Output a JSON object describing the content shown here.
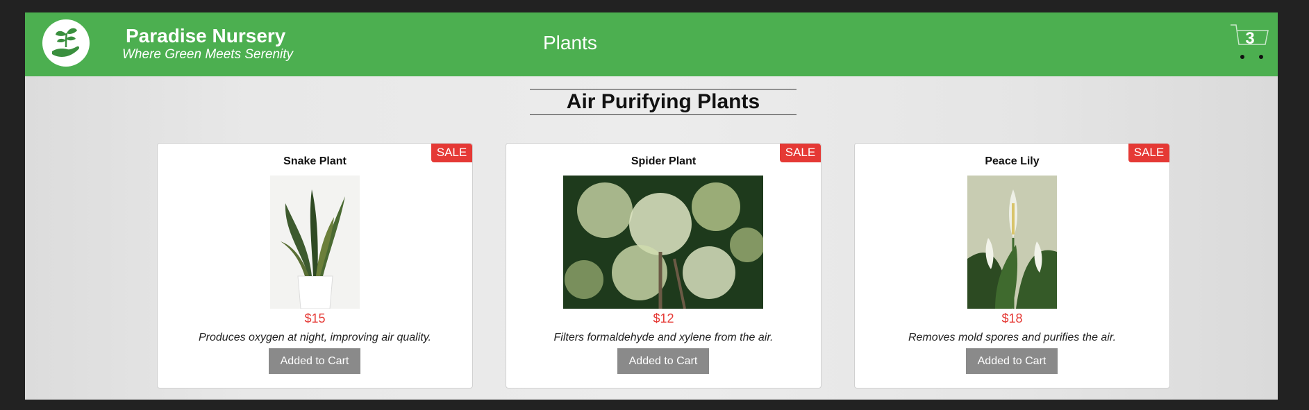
{
  "header": {
    "brand_name": "Paradise Nursery",
    "brand_tagline": "Where Green Meets Serenity",
    "nav_label": "Plants",
    "cart_count": "3"
  },
  "section": {
    "title": "Air Purifying Plants"
  },
  "products": [
    {
      "name": "Snake Plant",
      "badge": "SALE",
      "price": "$15",
      "description": "Produces oxygen at night, improving air quality.",
      "button": "Added to Cart"
    },
    {
      "name": "Spider Plant",
      "badge": "SALE",
      "price": "$12",
      "description": "Filters formaldehyde and xylene from the air.",
      "button": "Added to Cart"
    },
    {
      "name": "Peace Lily",
      "badge": "SALE",
      "price": "$18",
      "description": "Removes mold spores and purifies the air.",
      "button": "Added to Cart"
    }
  ],
  "colors": {
    "header_green": "#4caf50",
    "sale_red": "#e53935",
    "price_red": "#e53935",
    "button_gray": "#8a8a8a"
  },
  "icons": {
    "logo": "plant-in-hand-icon",
    "cart": "shopping-cart-icon"
  }
}
